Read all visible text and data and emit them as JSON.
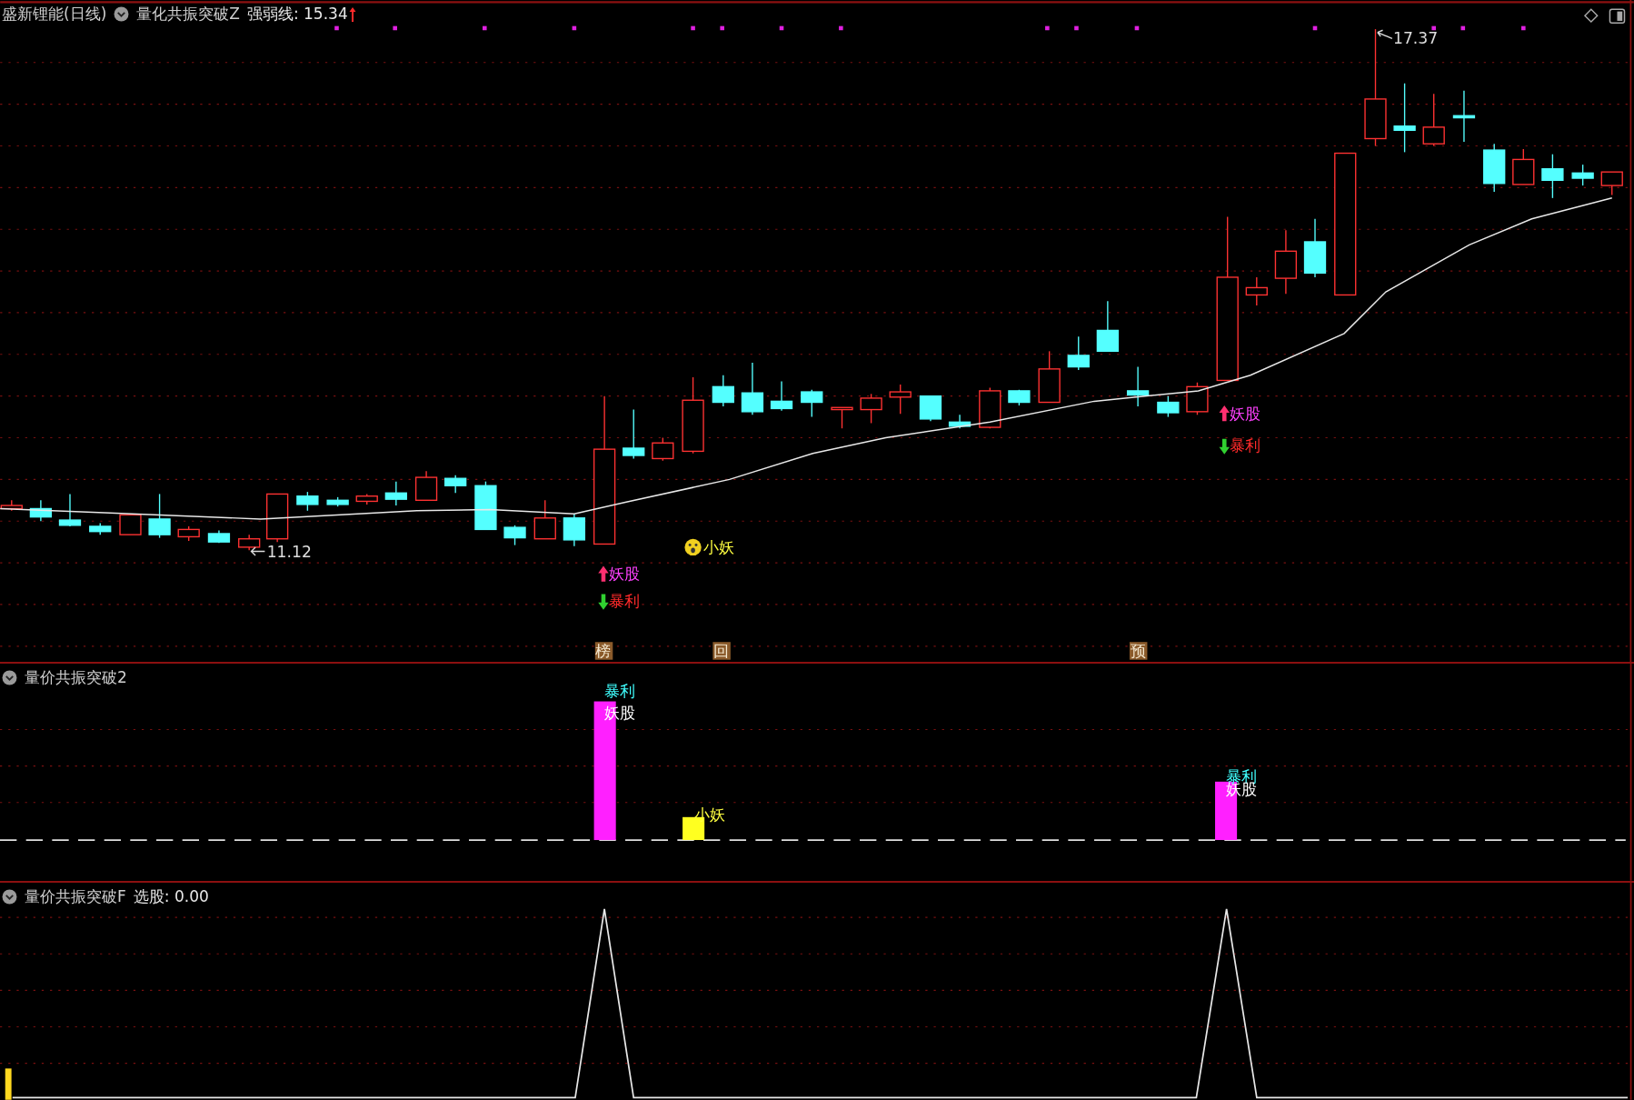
{
  "main_panel": {
    "title": "盛新锂能(日线)",
    "indicator": "量化共振突破Z",
    "reading": "强弱线: 15.34",
    "price_labels": [
      {
        "kind": "low",
        "text": "11.12"
      },
      {
        "kind": "high",
        "text": "17.37"
      }
    ],
    "signals": [
      {
        "kind": "up",
        "text": "妖股"
      },
      {
        "kind": "down",
        "text": "暴利"
      },
      {
        "kind": "face",
        "text": "小妖"
      },
      {
        "kind": "up",
        "text": "妖股"
      },
      {
        "kind": "down",
        "text": "暴利"
      }
    ],
    "tags": [
      "榜",
      "回",
      "预"
    ]
  },
  "volume_panel": {
    "title": "量价共振突破2",
    "labels": [
      {
        "kind": "profit",
        "text": "暴利"
      },
      {
        "kind": "stock",
        "text": "妖股"
      },
      {
        "kind": "small",
        "text": "小妖"
      },
      {
        "kind": "profit",
        "text": "暴利"
      },
      {
        "kind": "stock",
        "text": "妖股"
      }
    ]
  },
  "select_panel": {
    "title": "量价共振突破F",
    "reading": "选股: 0.00"
  }
}
